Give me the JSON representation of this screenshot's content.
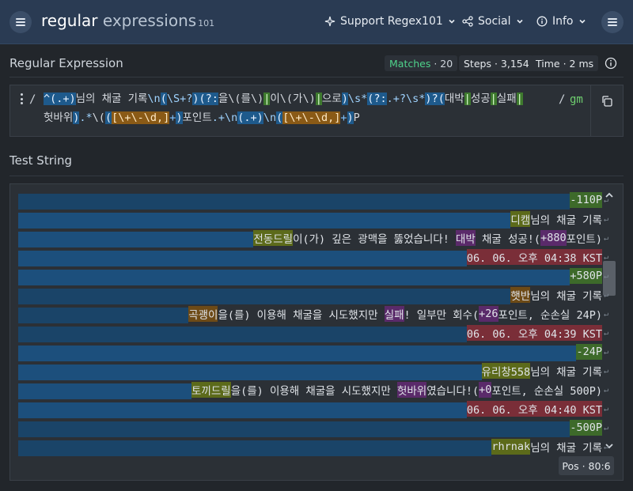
{
  "header": {
    "logo_main": "regular",
    "logo_ex": "expressions",
    "logo_ver": "101",
    "support": "Support Regex101",
    "social": "Social",
    "info": "Info"
  },
  "regex_section": {
    "title": "Regular Expression",
    "matches_label": "Matches",
    "matches_value": "· 20",
    "steps_label": "Steps",
    "steps_value": "· 3,154",
    "time_label": "Time",
    "time_value": "· 2 ms",
    "delimiter_open": "/",
    "delimiter_close": "/",
    "flags": "gm",
    "pattern_tokens": [
      [
        "t-grp",
        "^(.+)"
      ],
      [
        "t-lit",
        "님의 채굴 기록"
      ],
      [
        "t-esc",
        "\\n"
      ],
      [
        "t-grp",
        "("
      ],
      [
        "t-esc",
        "\\S+?"
      ],
      [
        "t-grp",
        ")"
      ],
      [
        "t-grp",
        "(?:"
      ],
      [
        "t-lit",
        "을\\(를\\)"
      ],
      [
        "t-alt",
        "|"
      ],
      [
        "t-lit",
        "이\\(가\\)"
      ],
      [
        "t-alt",
        "|"
      ],
      [
        "t-lit",
        "으로"
      ],
      [
        "t-grp",
        ")"
      ],
      [
        "t-esc",
        "\\s*"
      ],
      [
        "t-grp",
        "(?:"
      ],
      [
        "t-esc",
        ".+?\\s*"
      ],
      [
        "t-grp",
        ")?"
      ],
      [
        "t-grp",
        "("
      ],
      [
        "t-lit",
        "대박"
      ],
      [
        "t-alt",
        "|"
      ],
      [
        "t-lit",
        "성공"
      ],
      [
        "t-alt",
        "|"
      ],
      [
        "t-lit",
        "실패"
      ],
      [
        "t-alt",
        "|"
      ],
      [
        "t-lit",
        "헛바위"
      ],
      [
        "t-grp",
        ")"
      ],
      [
        "t-esc",
        ".*"
      ],
      [
        "t-lit",
        "\\("
      ],
      [
        "t-grp",
        "("
      ],
      [
        "t-cls2",
        "[\\+\\-\\d,]"
      ],
      [
        "t-q",
        "+"
      ],
      [
        "t-grp",
        ")"
      ],
      [
        "t-lit",
        "포인트"
      ],
      [
        "t-esc",
        ".+\\n"
      ],
      [
        "t-grp",
        "(.+)"
      ],
      [
        "t-esc",
        "\\n"
      ],
      [
        "t-grp",
        "("
      ],
      [
        "t-cls2",
        "[\\+\\-\\d,]"
      ],
      [
        "t-q",
        "+"
      ],
      [
        "t-grp",
        ")"
      ],
      [
        "t-lit",
        "P"
      ]
    ]
  },
  "test_section": {
    "title": "Test String",
    "pos_label": "Pos",
    "pos_value": "· 80:6",
    "lines": [
      {
        "band": "m2",
        "segs": [
          [
            "g-green",
            "-110P"
          ]
        ]
      },
      {
        "band": "m1",
        "segs": [
          [
            "g-olive",
            "디캠"
          ],
          [
            "",
            "님의 채굴 기록"
          ]
        ]
      },
      {
        "band": "m1",
        "segs": [
          [
            "g-olive",
            "전동드릴"
          ],
          [
            "",
            "이(가) 깊은 광맥을 뚫었습니다! "
          ],
          [
            "g-purple",
            "대박"
          ],
          [
            "",
            " 채굴 성공!("
          ],
          [
            "g-purple",
            "+880"
          ],
          [
            "",
            "포인트)"
          ]
        ]
      },
      {
        "band": "m1",
        "segs": [
          [
            "g-red",
            "06. 06. 오후 04:38 KST"
          ]
        ]
      },
      {
        "band": "m1",
        "segs": [
          [
            "g-green",
            "+580P"
          ]
        ]
      },
      {
        "band": "m2",
        "segs": [
          [
            "g-brown",
            "햇반"
          ],
          [
            "",
            "님의 채굴 기록"
          ]
        ]
      },
      {
        "band": "m2",
        "segs": [
          [
            "g-brown",
            "곡괭이"
          ],
          [
            "",
            "을(를) 이용해 채굴을 시도했지만 "
          ],
          [
            "g-purple",
            "실패"
          ],
          [
            "",
            "! 일부만 회수("
          ],
          [
            "g-purple",
            "+26"
          ],
          [
            "",
            "포인트, 순손실 24P)"
          ]
        ]
      },
      {
        "band": "m2",
        "segs": [
          [
            "g-red",
            "06. 06. 오후 04:39 KST"
          ]
        ]
      },
      {
        "band": "m1",
        "segs": [
          [
            "g-green",
            "-24P"
          ]
        ]
      },
      {
        "band": "m1",
        "segs": [
          [
            "g-olive",
            "유리창558"
          ],
          [
            "",
            "님의 채굴 기록"
          ]
        ]
      },
      {
        "band": "m1",
        "segs": [
          [
            "g-olive",
            "토끼드릴"
          ],
          [
            "",
            "을(를) 이용해 채굴을 시도했지만 "
          ],
          [
            "g-purple",
            "헛바위"
          ],
          [
            "",
            "였습니다!("
          ],
          [
            "g-purple",
            "+0"
          ],
          [
            "",
            "포인트, 순손실 500P)"
          ]
        ]
      },
      {
        "band": "m1",
        "segs": [
          [
            "g-red",
            "06. 06. 오후 04:40 KST"
          ]
        ]
      },
      {
        "band": "m2",
        "segs": [
          [
            "g-green",
            "-500P"
          ]
        ]
      },
      {
        "band": "m2",
        "segs": [
          [
            "g-olive",
            "rhrnak"
          ],
          [
            "",
            "님의 채굴 기록"
          ]
        ]
      }
    ]
  }
}
